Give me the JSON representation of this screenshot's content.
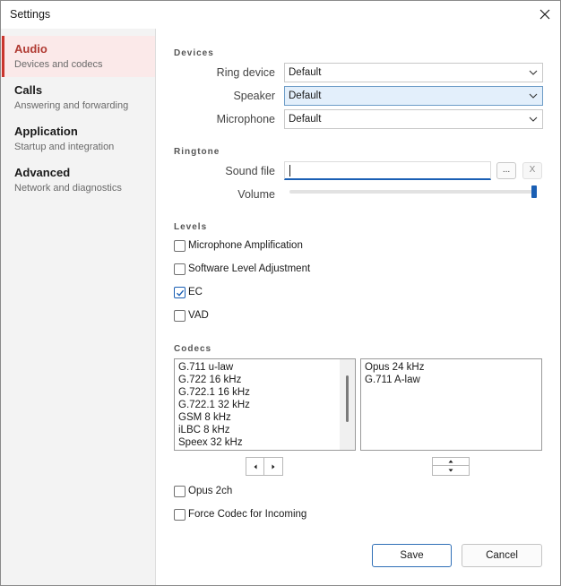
{
  "window": {
    "title": "Settings"
  },
  "sidebar": {
    "items": [
      {
        "title": "Audio",
        "subtitle": "Devices and codecs"
      },
      {
        "title": "Calls",
        "subtitle": "Answering and forwarding"
      },
      {
        "title": "Application",
        "subtitle": "Startup and integration"
      },
      {
        "title": "Advanced",
        "subtitle": "Network and diagnostics"
      }
    ],
    "active": "Audio"
  },
  "devices": {
    "heading": "Devices",
    "ring_device": {
      "label": "Ring device",
      "value": "Default"
    },
    "speaker": {
      "label": "Speaker",
      "value": "Default"
    },
    "microphone": {
      "label": "Microphone",
      "value": "Default"
    }
  },
  "ringtone": {
    "heading": "Ringtone",
    "sound_file": {
      "label": "Sound file",
      "value": "",
      "browse_label": "...",
      "clear_label": "X"
    },
    "volume": {
      "label": "Volume",
      "level": 1.0
    }
  },
  "levels": {
    "heading": "Levels",
    "options": [
      {
        "label": "Microphone Amplification",
        "checked": false
      },
      {
        "label": "Software Level Adjustment",
        "checked": false
      },
      {
        "label": "EC",
        "checked": true
      },
      {
        "label": "VAD",
        "checked": false
      }
    ]
  },
  "codecs": {
    "heading": "Codecs",
    "available": [
      "G.711 u-law",
      "G.722 16 kHz",
      "G.722.1 16 kHz",
      "G.722.1 32 kHz",
      "GSM 8 kHz",
      "iLBC 8 kHz",
      "Speex 32 kHz"
    ],
    "enabled": [
      "Opus 24 kHz",
      "G.711 A-law"
    ],
    "options": [
      {
        "label": "Opus 2ch",
        "checked": false
      },
      {
        "label": "Force Codec for Incoming",
        "checked": false
      }
    ]
  },
  "buttons": {
    "save": "Save",
    "cancel": "Cancel"
  },
  "colors": {
    "accent": "#1a5fb4",
    "active_nav": "#b03a32",
    "active_nav_bg": "#fbe9e9"
  }
}
